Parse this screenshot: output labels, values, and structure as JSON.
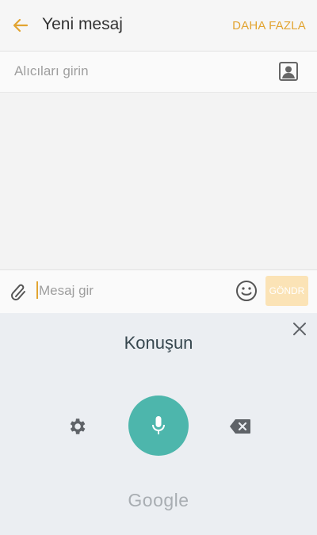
{
  "header": {
    "title": "Yeni mesaj",
    "more_label": "DAHA FAZLA"
  },
  "recipient": {
    "placeholder": "Alıcıları girin"
  },
  "compose": {
    "placeholder": "Mesaj gir",
    "send_label": "GÖNDR"
  },
  "voice": {
    "prompt": "Konuşun",
    "brand": "Google"
  },
  "colors": {
    "accent": "#e2a431",
    "mic": "#4db6ac"
  }
}
